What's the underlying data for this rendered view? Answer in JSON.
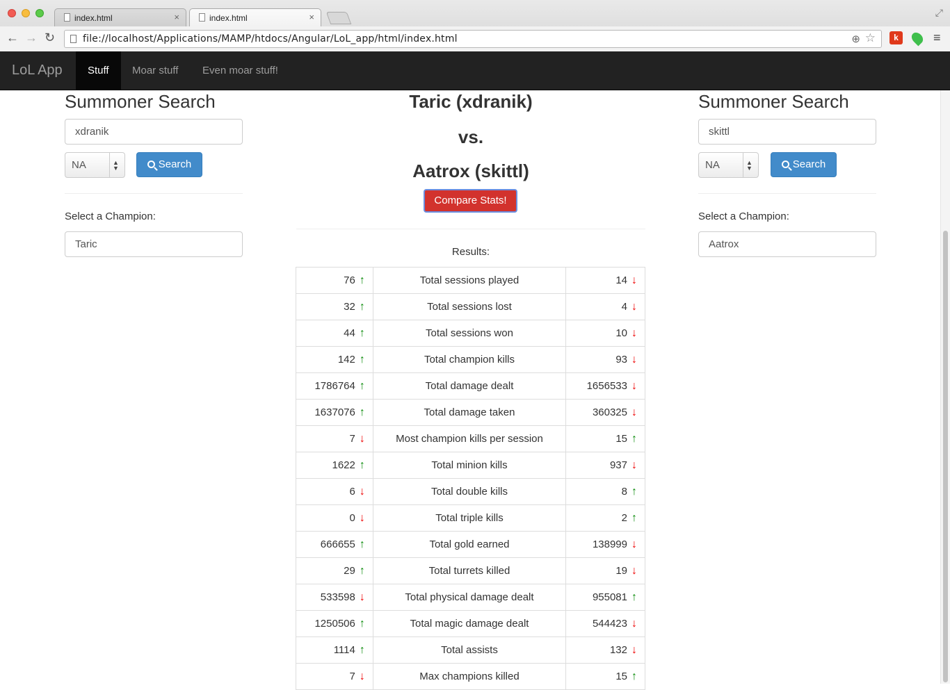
{
  "browser": {
    "tabs": [
      {
        "label": "index.html",
        "close": "×"
      },
      {
        "label": "index.html",
        "close": "×"
      }
    ],
    "url": "file://localhost/Applications/MAMP/htdocs/Angular/LoL_app/html/index.html",
    "ext_k": "k"
  },
  "navbar": {
    "brand": "LoL App",
    "items": [
      "Stuff",
      "Moar stuff",
      "Even moar stuff!"
    ],
    "active_index": 0
  },
  "left": {
    "title": "Summoner Search",
    "summoner": "xdranik",
    "region": "NA",
    "search_label": "Search",
    "champ_label": "Select a Champion:",
    "champion": "Taric"
  },
  "right": {
    "title": "Summoner Search",
    "summoner": "skittl",
    "region": "NA",
    "search_label": "Search",
    "champ_label": "Select a Champion:",
    "champion": "Aatrox"
  },
  "center": {
    "player1": "Taric (xdranik)",
    "vs": "vs.",
    "player2": "Aatrox (skittl)",
    "compare_label": "Compare Stats!",
    "results_label": "Results:"
  },
  "colors": {
    "up": "#0a8a0a",
    "down": "#ee0000",
    "danger": "#d2322d",
    "primary": "#428bca"
  },
  "stats": [
    {
      "stat": "Total sessions played",
      "left": "76",
      "left_dir": "up",
      "right": "14",
      "right_dir": "down"
    },
    {
      "stat": "Total sessions lost",
      "left": "32",
      "left_dir": "up",
      "right": "4",
      "right_dir": "down"
    },
    {
      "stat": "Total sessions won",
      "left": "44",
      "left_dir": "up",
      "right": "10",
      "right_dir": "down"
    },
    {
      "stat": "Total champion kills",
      "left": "142",
      "left_dir": "up",
      "right": "93",
      "right_dir": "down"
    },
    {
      "stat": "Total damage dealt",
      "left": "1786764",
      "left_dir": "up",
      "right": "1656533",
      "right_dir": "down"
    },
    {
      "stat": "Total damage taken",
      "left": "1637076",
      "left_dir": "up",
      "right": "360325",
      "right_dir": "down"
    },
    {
      "stat": "Most champion kills per session",
      "left": "7",
      "left_dir": "down",
      "right": "15",
      "right_dir": "up"
    },
    {
      "stat": "Total minion kills",
      "left": "1622",
      "left_dir": "up",
      "right": "937",
      "right_dir": "down"
    },
    {
      "stat": "Total double kills",
      "left": "6",
      "left_dir": "down",
      "right": "8",
      "right_dir": "up"
    },
    {
      "stat": "Total triple kills",
      "left": "0",
      "left_dir": "down",
      "right": "2",
      "right_dir": "up"
    },
    {
      "stat": "Total gold earned",
      "left": "666655",
      "left_dir": "up",
      "right": "138999",
      "right_dir": "down"
    },
    {
      "stat": "Total turrets killed",
      "left": "29",
      "left_dir": "up",
      "right": "19",
      "right_dir": "down"
    },
    {
      "stat": "Total physical damage dealt",
      "left": "533598",
      "left_dir": "down",
      "right": "955081",
      "right_dir": "up"
    },
    {
      "stat": "Total magic damage dealt",
      "left": "1250506",
      "left_dir": "up",
      "right": "544423",
      "right_dir": "down"
    },
    {
      "stat": "Total assists",
      "left": "1114",
      "left_dir": "up",
      "right": "132",
      "right_dir": "down"
    },
    {
      "stat": "Max champions killed",
      "left": "7",
      "left_dir": "down",
      "right": "15",
      "right_dir": "up"
    }
  ]
}
